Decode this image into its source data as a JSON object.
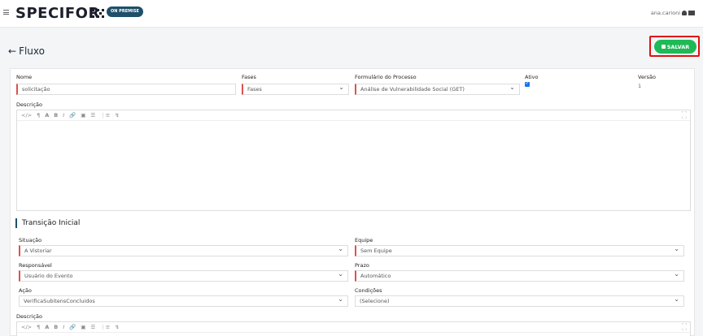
{
  "header": {
    "logo": "SPECIFOR",
    "badge": "ON PREMISE",
    "user": "ana.carioni"
  },
  "page": {
    "back_arrow": "←",
    "title": "Fluxo",
    "save_label": "SALVAR"
  },
  "form": {
    "nome_label": "Nome",
    "nome_value": "solicitação",
    "fases_label": "Fases",
    "fases_value": "Fases",
    "formulario_label": "Formulário do Processo",
    "formulario_value": "Análise de Vulnerabilidade Social (GET)",
    "ativo_label": "Ativo",
    "versao_label": "Versão",
    "versao_value": "1",
    "descricao_label": "Descrição"
  },
  "toolbar": [
    "</>",
    "¶",
    "A",
    "B",
    "I",
    "🔗",
    "▣",
    "☰",
    "⋮≡",
    "↯"
  ],
  "transicao": {
    "title": "Transição Inicial",
    "situacao_label": "Situação",
    "situacao_value": "A Vistoriar",
    "equipe_label": "Equipe",
    "equipe_value": "Sem Equipe",
    "responsavel_label": "Responsável",
    "responsavel_value": "Usuário do Evento",
    "prazo_label": "Prazo",
    "prazo_value": "Automático",
    "acao_label": "Ação",
    "acao_value": "VerificaSubitensConcluidos",
    "condicoes_label": "Condições",
    "condicoes_value": "(Selecione)",
    "descricao_label": "Descrição"
  }
}
